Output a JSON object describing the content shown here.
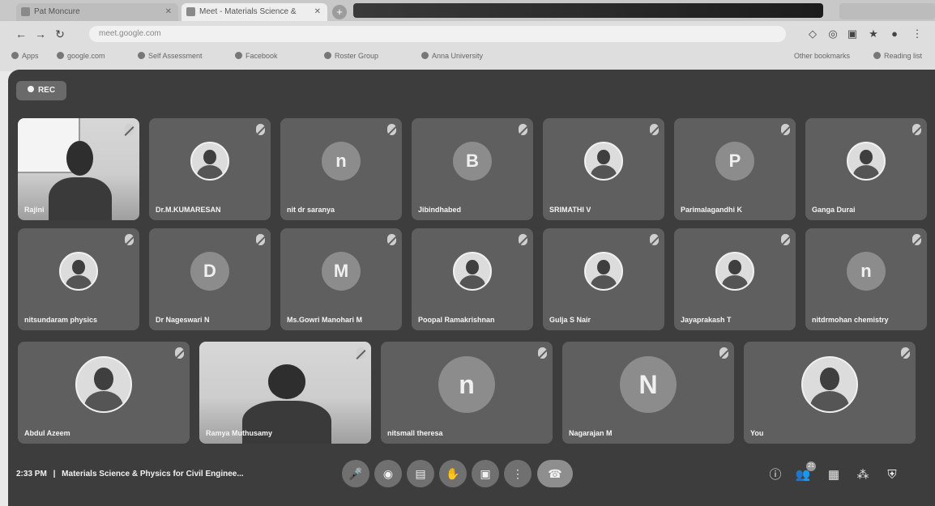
{
  "browser": {
    "tabs": [
      {
        "label": "Pat Moncure"
      },
      {
        "label": "Meet - Materials Science &"
      }
    ],
    "url": "meet.google.com",
    "bookmarks": [
      "Apps",
      "google.com",
      "Self Assessment",
      "Facebook",
      "Roster Group",
      "Anna University"
    ],
    "bookmarks_right": [
      "Other bookmarks",
      "Reading list"
    ]
  },
  "meet": {
    "rec_label": "REC",
    "meeting_time": "2:33 PM",
    "separator": "|",
    "meeting_title": "Materials Science & Physics for Civil Enginee...",
    "participants_count": "21",
    "rows": [
      [
        {
          "name": "Rajini",
          "type": "video"
        },
        {
          "name": "Dr.M.KUMARESAN",
          "type": "photo"
        },
        {
          "name": "nit dr saranya",
          "type": "letter",
          "letter": "n"
        },
        {
          "name": "Jibindhabed",
          "type": "letter",
          "letter": "B"
        },
        {
          "name": "SRIMATHI V",
          "type": "photo"
        },
        {
          "name": "Parimalagandhi K",
          "type": "letter",
          "letter": "P"
        },
        {
          "name": "Ganga Durai",
          "type": "photo"
        }
      ],
      [
        {
          "name": "nitsundaram physics",
          "type": "photo"
        },
        {
          "name": "Dr Nageswari N",
          "type": "letter",
          "letter": "D"
        },
        {
          "name": "Ms.Gowri Manohari M",
          "type": "letter",
          "letter": "M"
        },
        {
          "name": "Poopal Ramakrishnan",
          "type": "photo"
        },
        {
          "name": "Gulja S Nair",
          "type": "photo"
        },
        {
          "name": "Jayaprakash T",
          "type": "photo"
        },
        {
          "name": "nitdrmohan chemistry",
          "type": "letter",
          "letter": "n"
        }
      ],
      [
        {
          "name": "Abdul Azeem",
          "type": "photo"
        },
        {
          "name": "Ramya Muthusamy",
          "type": "video"
        },
        {
          "name": "nitsmall theresa",
          "type": "letter",
          "letter": "n"
        },
        {
          "name": "Nagarajan M",
          "type": "letter",
          "letter": "N"
        },
        {
          "name": "You",
          "type": "photo"
        }
      ]
    ]
  }
}
